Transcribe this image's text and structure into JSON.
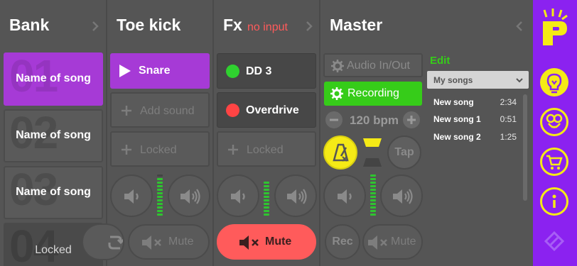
{
  "bank": {
    "title": "Bank",
    "slots": [
      {
        "number": "01",
        "label": "Name of song"
      },
      {
        "number": "02",
        "label": "Name of song"
      },
      {
        "number": "03",
        "label": "Name of song"
      },
      {
        "number": "04",
        "label": "Locked"
      }
    ]
  },
  "toe_kick": {
    "title": "Toe kick",
    "pads": [
      {
        "label": "Snare"
      },
      {
        "label": "Add sound"
      },
      {
        "label": "Locked"
      }
    ],
    "mute_label": "Mute"
  },
  "fx": {
    "title": "Fx",
    "status": "no input",
    "pads": [
      {
        "label": "DD 3",
        "led": "#2fd12f"
      },
      {
        "label": "Overdrive",
        "led": "#ff4444"
      },
      {
        "label": "Locked"
      }
    ],
    "mute_label": "Mute"
  },
  "master": {
    "title": "Master",
    "audio_button": "Audio In/Out",
    "recording_button": "Recording",
    "tempo": "120 bpm",
    "tap_label": "Tap",
    "rec_label": "Rec",
    "mute_label": "Mute"
  },
  "songs": {
    "edit_label": "Edit",
    "dropdown_value": "My songs",
    "items": [
      {
        "name": "New song",
        "duration": "2:34"
      },
      {
        "name": "New song 1",
        "duration": "0:51"
      },
      {
        "name": "New song 2",
        "duration": "1:25"
      }
    ]
  },
  "sidebar": {
    "icons": [
      "logo-icon",
      "bulb-icon",
      "owl-icon",
      "cart-icon",
      "info-icon",
      "rotate-icon"
    ]
  },
  "colors": {
    "accent_purple": "#a63ad6",
    "sidebar_purple": "#8b22f0",
    "recording_green": "#36cc19",
    "mute_red": "#ff5b5b",
    "metronome_yellow": "#f5ea16"
  }
}
